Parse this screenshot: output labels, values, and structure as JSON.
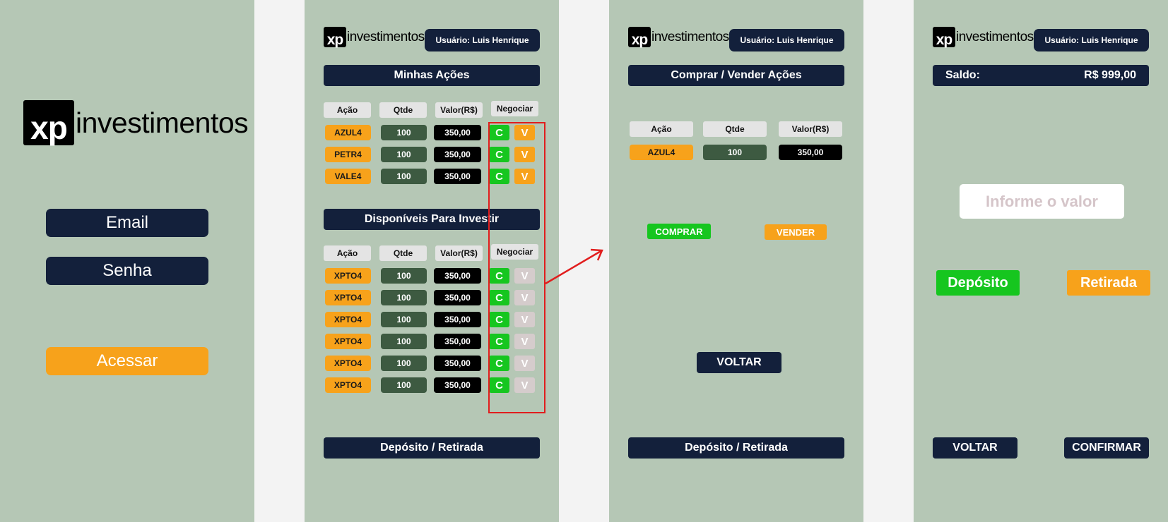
{
  "brand": {
    "mark": "xp",
    "word": "investimentos"
  },
  "login": {
    "email_label": "Email",
    "password_label": "Senha",
    "submit_label": "Acessar"
  },
  "user_badge": "Usuário: Luis Henrique",
  "portfolio": {
    "title": "Minhas Ações",
    "headers": [
      "Ação",
      "Qtde",
      "Valor(R$)",
      "Negociar"
    ],
    "rows": [
      {
        "ticker": "AZUL4",
        "qty": "100",
        "value": "350,00",
        "buy": "C",
        "sell": "V"
      },
      {
        "ticker": "PETR4",
        "qty": "100",
        "value": "350,00",
        "buy": "C",
        "sell": "V"
      },
      {
        "ticker": "VALE4",
        "qty": "100",
        "value": "350,00",
        "buy": "C",
        "sell": "V"
      }
    ]
  },
  "available": {
    "title": "Disponíveis Para Investir",
    "headers": [
      "Ação",
      "Qtde",
      "Valor(R$)",
      "Negociar"
    ],
    "rows": [
      {
        "ticker": "XPTO4",
        "qty": "100",
        "value": "350,00",
        "buy": "C",
        "sell": "V"
      },
      {
        "ticker": "XPTO4",
        "qty": "100",
        "value": "350,00",
        "buy": "C",
        "sell": "V"
      },
      {
        "ticker": "XPTO4",
        "qty": "100",
        "value": "350,00",
        "buy": "C",
        "sell": "V"
      },
      {
        "ticker": "XPTO4",
        "qty": "100",
        "value": "350,00",
        "buy": "C",
        "sell": "V"
      },
      {
        "ticker": "XPTO4",
        "qty": "100",
        "value": "350,00",
        "buy": "C",
        "sell": "V"
      },
      {
        "ticker": "XPTO4",
        "qty": "100",
        "value": "350,00",
        "buy": "C",
        "sell": "V"
      }
    ]
  },
  "deposit_withdraw_label": "Depósito / Retirada",
  "trade": {
    "title": "Comprar / Vender Ações",
    "headers": [
      "Ação",
      "Qtde",
      "Valor(R$)"
    ],
    "row": {
      "ticker": "AZUL4",
      "qty": "100",
      "value": "350,00"
    },
    "buy_label": "COMPRAR",
    "sell_label": "VENDER",
    "back_label": "VOLTAR"
  },
  "wallet": {
    "balance_label": "Saldo:",
    "balance_value": "R$ 999,00",
    "amount_placeholder": "Informe o valor",
    "deposit_label": "Depósito",
    "withdraw_label": "Retirada",
    "back_label": "VOLTAR",
    "confirm_label": "CONFIRMAR"
  },
  "colors": {
    "screen_bg": "#b5c7b5",
    "navy": "#13203b",
    "orange": "#f7a21b",
    "green": "#16c61f",
    "dark_green": "#3d5a41",
    "annotation_red": "#e11d1d"
  }
}
